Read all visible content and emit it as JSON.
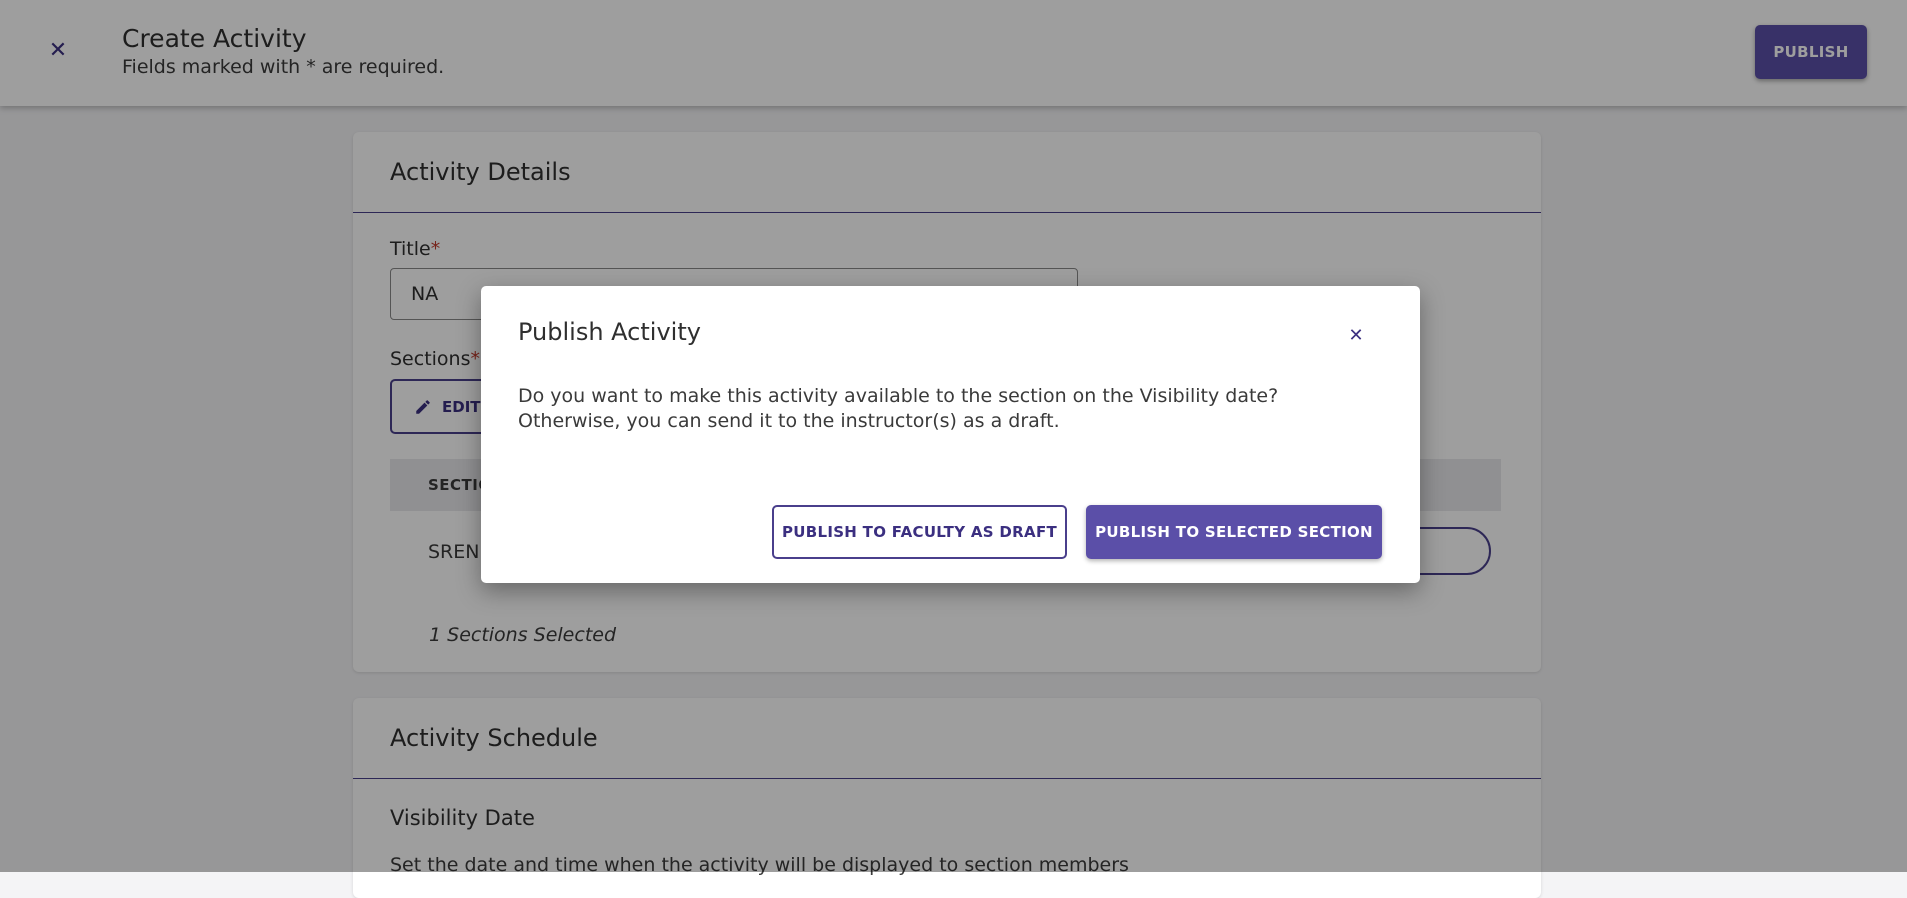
{
  "header": {
    "close_icon": "close-icon",
    "title": "Create Activity",
    "subtitle": "Fields marked with * are required.",
    "publish_label": "PUBLISH"
  },
  "activity_details": {
    "title": "Activity Details",
    "title_label": "Title",
    "required_mark": "*",
    "title_value": "NA",
    "sections_label": "Sections",
    "edit_label": "EDIT",
    "edit_icon": "pencil-icon",
    "table_header": "SECTIO",
    "row_text": "SREN C",
    "selected_count": "1 Sections Selected"
  },
  "activity_schedule": {
    "title": "Activity Schedule",
    "visibility_label": "Visibility Date",
    "visibility_help": "Set the date and time when the activity will be displayed to section members"
  },
  "modal": {
    "title": "Publish Activity",
    "close_icon": "close-icon",
    "body": "Do you want to make this activity available to the section on the Visibility date? Otherwise, you can send it to the instructor(s) as a draft.",
    "draft_label": "PUBLISH TO FACULTY AS DRAFT",
    "publish_section_label": "PUBLISH TO SELECTED SECTION"
  },
  "colors": {
    "primary": "#5b4fa8",
    "primary_dark": "#3b2f80",
    "required": "#c0392b"
  }
}
